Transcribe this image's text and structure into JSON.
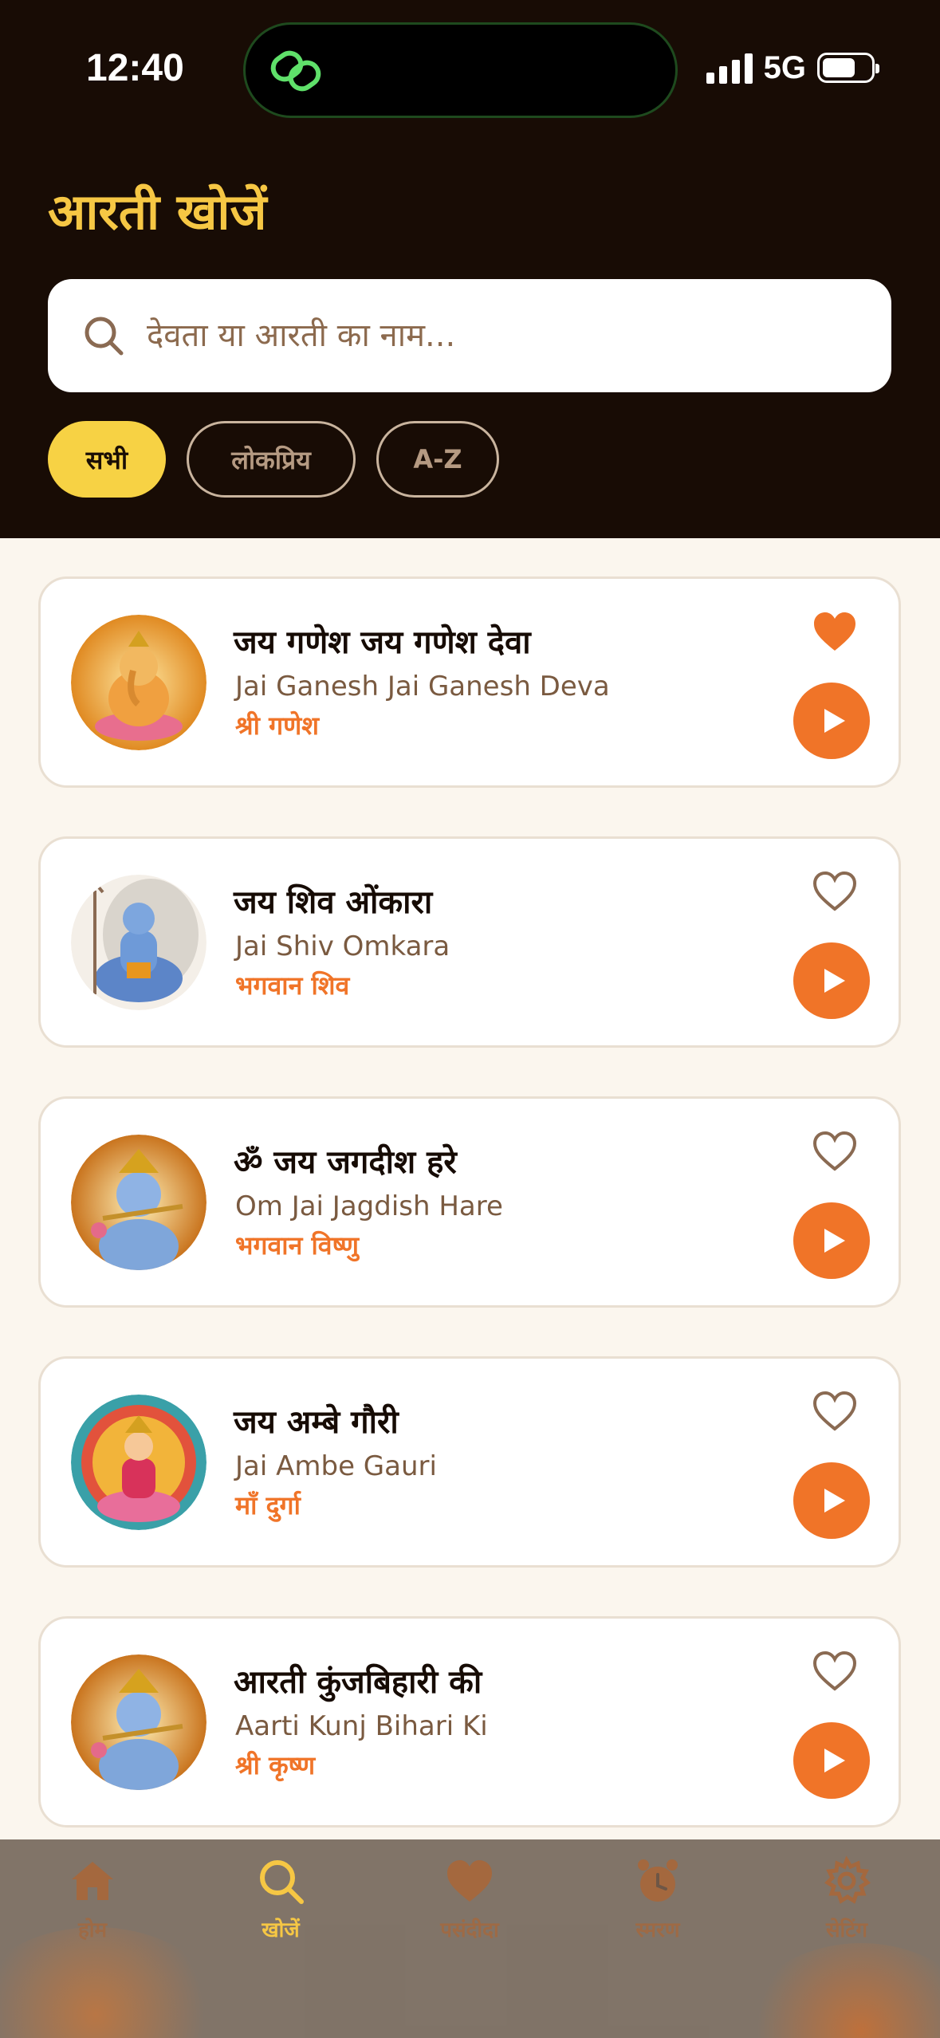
{
  "status_bar": {
    "time": "12:40",
    "network": "5G"
  },
  "page_title": "आरती खोजें",
  "search": {
    "placeholder": "देवता या आरती का नाम..."
  },
  "filters": [
    {
      "label": "सभी",
      "active": true
    },
    {
      "label": "लोकप्रिय",
      "active": false
    },
    {
      "label": "A-Z",
      "active": false
    }
  ],
  "aartis": [
    {
      "title": "जय गणेश जय गणेश देवा",
      "subtitle": "Jai Ganesh Jai Ganesh Deva",
      "deity": "श्री गणेश",
      "favorite": true,
      "image_icon": "ganesh-image"
    },
    {
      "title": "जय शिव ओंकारा",
      "subtitle": "Jai Shiv Omkara",
      "deity": "भगवान शिव",
      "favorite": false,
      "image_icon": "shiv-image"
    },
    {
      "title": "ॐ जय जगदीश हरे",
      "subtitle": "Om Jai Jagdish Hare",
      "deity": "भगवान विष्णु",
      "favorite": false,
      "image_icon": "vishnu-image"
    },
    {
      "title": "जय अम्बे गौरी",
      "subtitle": "Jai Ambe Gauri",
      "deity": "माँ दुर्गा",
      "favorite": false,
      "image_icon": "durga-image"
    },
    {
      "title": "आरती कुंजबिहारी की",
      "subtitle": "Aarti Kunj Bihari Ki",
      "deity": "श्री कृष्ण",
      "favorite": false,
      "image_icon": "krishna-image"
    }
  ],
  "tabs": [
    {
      "label": "होम",
      "icon": "home-icon",
      "active": false
    },
    {
      "label": "खोजें",
      "icon": "search-icon",
      "active": true
    },
    {
      "label": "पसंदीदा",
      "icon": "heart-icon",
      "active": false
    },
    {
      "label": "स्मरण",
      "icon": "alarm-icon",
      "active": false
    },
    {
      "label": "सेटिंग",
      "icon": "gear-icon",
      "active": false
    }
  ],
  "colors": {
    "header_bg": "#180C05",
    "accent": "#F07428",
    "title": "#F6C744",
    "page_bg": "#FBF6EE"
  }
}
